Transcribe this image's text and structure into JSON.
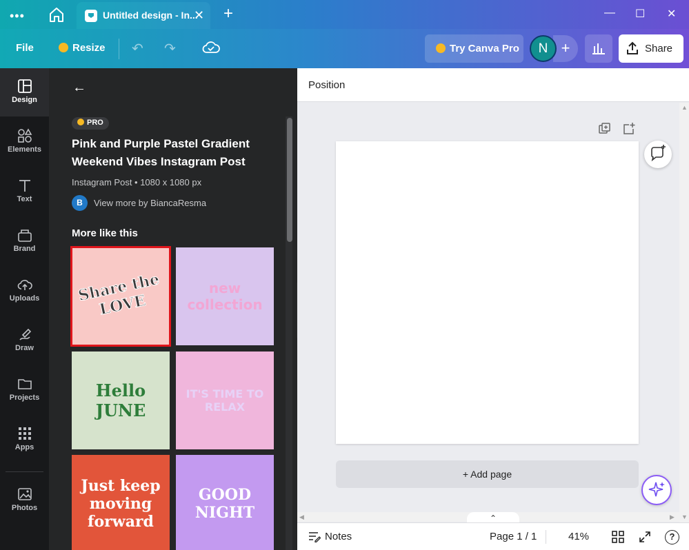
{
  "titlebar": {
    "tab_title": "Untitled design - In...",
    "menu_glyph": "•••",
    "close_glyph": "✕",
    "new_tab_glyph": "+",
    "minimize_glyph": "—",
    "maximize_glyph": "☐",
    "window_close_glyph": "✕"
  },
  "toolbar": {
    "file_label": "File",
    "resize_label": "Resize",
    "undo_glyph": "↶",
    "redo_glyph": "↷",
    "try_pro_label": "Try Canva Pro",
    "avatar_initial": "N",
    "add_glyph": "+",
    "share_label": "Share"
  },
  "rail": {
    "items": [
      {
        "label": "Design",
        "icon": "layout-icon"
      },
      {
        "label": "Elements",
        "icon": "shapes-icon"
      },
      {
        "label": "Text",
        "icon": "text-icon"
      },
      {
        "label": "Brand",
        "icon": "brand-icon"
      },
      {
        "label": "Uploads",
        "icon": "upload-cloud-icon"
      },
      {
        "label": "Draw",
        "icon": "draw-icon"
      },
      {
        "label": "Projects",
        "icon": "folder-icon"
      },
      {
        "label": "Apps",
        "icon": "apps-grid-icon"
      },
      {
        "label": "Photos",
        "icon": "image-icon"
      }
    ]
  },
  "panel": {
    "back_glyph": "←",
    "pro_label": "PRO",
    "title": "Pink and Purple Pastel Gradient Weekend Vibes Instagram Post",
    "meta": "Instagram Post • 1080 x 1080 px",
    "author_initial": "B",
    "author_link": "View more by BiancaResma",
    "more_like_this": "More like this",
    "collapse_glyph": "‹",
    "thumbnails": [
      {
        "text": "Share the LOVE",
        "bg": "#f9c9c6",
        "fg": "#3a3a3a"
      },
      {
        "text": "new collection",
        "bg": "#d9c5ee",
        "fg": "#f2a6d4"
      },
      {
        "text": "Hello JUNE",
        "bg": "#d6e3cc",
        "fg": "#2e7d3a"
      },
      {
        "text": "IT'S TIME TO RELAX",
        "bg": "#f0b6dc",
        "fg": "#e7d2f7"
      },
      {
        "text": "Just keep moving forward",
        "bg": "#e2553a",
        "fg": "#ffffff"
      },
      {
        "text": "GOOD NIGHT",
        "bg": "#c39af0",
        "fg": "#ffffff"
      }
    ]
  },
  "canvas": {
    "position_label": "Position",
    "add_page_label": "+ Add page",
    "chevron_up_glyph": "⌃"
  },
  "footer": {
    "notes_label": "Notes",
    "page_indicator": "Page 1 / 1",
    "zoom": "41%",
    "help_glyph": "?"
  },
  "colors": {
    "accent_teal": "#12a9b5",
    "accent_purple": "#7150d6",
    "selected_outline": "#e0151b"
  }
}
